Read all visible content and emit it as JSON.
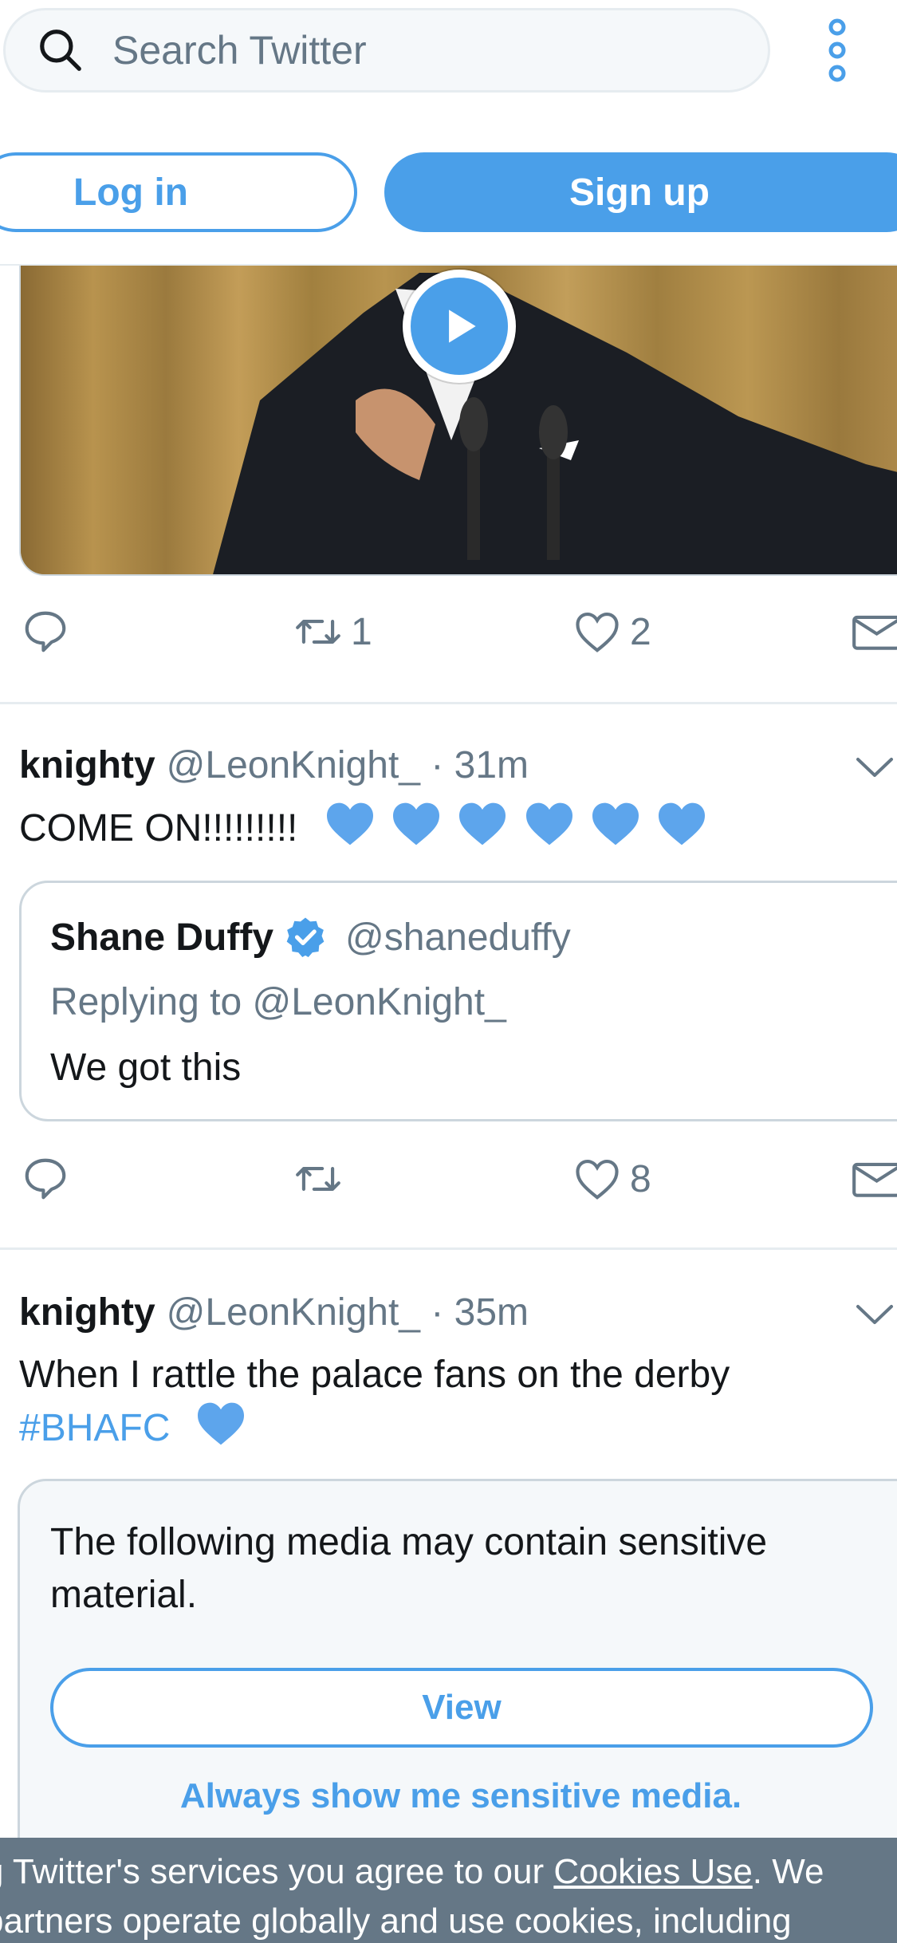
{
  "colors": {
    "brand_blue": "#4a9fe9",
    "text_primary": "#14171a",
    "text_secondary": "#657786",
    "border": "#ccd6dd",
    "cookie_bar": "#657786"
  },
  "header": {
    "search": {
      "placeholder": "Search Twitter",
      "icon": "search-icon"
    },
    "more_icon": "more-vertical-icon",
    "login_label": "Log in",
    "signup_label": "Sign up"
  },
  "tweet_1_actions": {
    "reply_count": "",
    "retweet_count": "1",
    "like_count": "2"
  },
  "tweet_2": {
    "name": "knighty",
    "handle": "@LeonKnight_",
    "time": "· 31m",
    "text": "COME ON!!!!!!!!!",
    "emoji_hearts": 6,
    "quote": {
      "name": "Shane Duffy",
      "handle": "@shaneduffy",
      "replying": "Replying to @LeonKnight_",
      "text": "We got this"
    },
    "actions": {
      "retweet_count": "",
      "like_count": "8"
    }
  },
  "tweet_3": {
    "name": "knighty",
    "handle": "@LeonKnight_",
    "time": "· 35m",
    "text_line1": "When I rattle the palace fans on the derby",
    "hashtag": "#BHAFC",
    "sensitive": {
      "message": "The following media may contain sensitive material.",
      "view_label": "View",
      "always_label": "Always show me sensitive media."
    }
  },
  "cookie_bar": {
    "line1_pre": "g Twitter's services you agree to our ",
    "line1_link": "Cookies Use",
    "line1_post": ". We",
    "line2": "partners operate globally and use cookies, including"
  }
}
